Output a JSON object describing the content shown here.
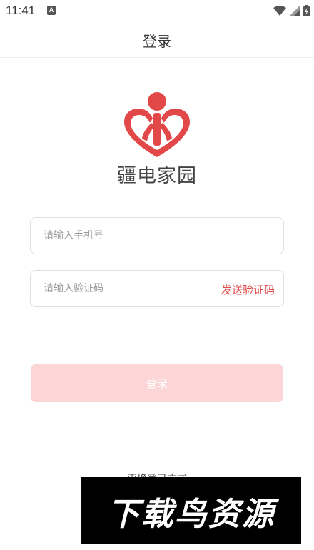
{
  "status_bar": {
    "time": "11:41",
    "notification_icon": "A",
    "icons": [
      "wifi-icon",
      "signal-icon",
      "battery-icon"
    ]
  },
  "header": {
    "title": "登录"
  },
  "logo": {
    "brand_name": "疆电家园",
    "icon": "hearts-person-logo-icon",
    "colors": {
      "red": "#e34848"
    }
  },
  "form": {
    "phone": {
      "value": "",
      "placeholder": "请输入手机号"
    },
    "code": {
      "value": "",
      "placeholder": "请输入验证码"
    },
    "send_code_label": "发送验证码",
    "login_label": "登录",
    "login_button_color": "#fcd6d6"
  },
  "footer": {
    "switch_login_label": "更换登录方式"
  },
  "watermark": {
    "text": "下载鸟资源"
  }
}
